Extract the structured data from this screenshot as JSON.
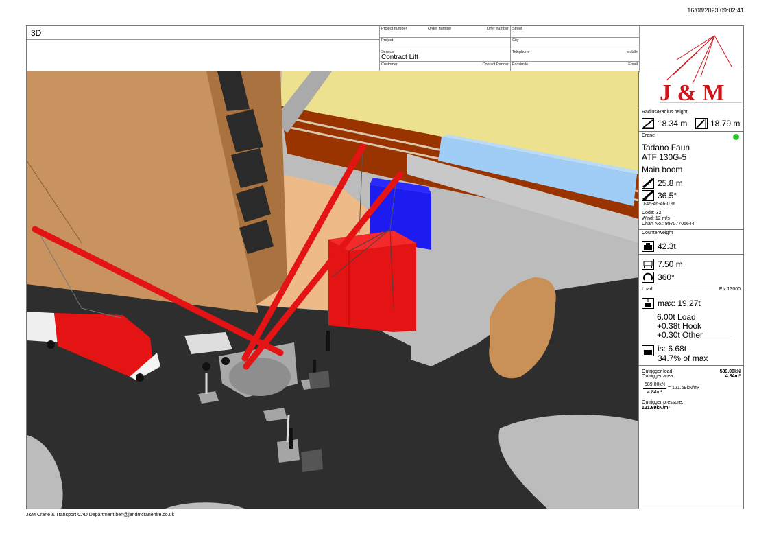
{
  "timestamp": "16/08/2023 09:02:41",
  "view_title": "3D",
  "header": {
    "project_number_label": "Project number",
    "order_number_label": "Order number",
    "offer_number_label": "Offer number",
    "street_label": "Street",
    "project_label": "Project",
    "city_label": "City",
    "service_label": "Service",
    "service_value": "Contract Lift",
    "telephone_label": "Telephone",
    "mobile_label": "Mobile",
    "customer_label": "Customer",
    "contact_partner_label": "Contact Partner",
    "facsimile_label": "Facsimile",
    "email_label": "Email"
  },
  "logo": {
    "text": "J & M",
    "color": "#d0141b"
  },
  "radius": {
    "label": "Radius/Radius height",
    "radius_value": "18.34 m",
    "height_value": "18.79 m"
  },
  "crane": {
    "label": "Crane",
    "badge": "1",
    "make": "Tadano Faun",
    "model": "ATF 130G-5",
    "boom_type": "Main boom",
    "boom_length": "25.8 m",
    "boom_angle": "36.5°",
    "telescoping": "0-46-46-46-0 %",
    "code": "Code: 32",
    "wind": "Wind: 12 m/s",
    "chart_no": "Chart No.: 99707705644"
  },
  "counterweight": {
    "label": "Counterweight",
    "value": "42.3t"
  },
  "outrigger_base": {
    "span": "7.50 m",
    "slew": "360°"
  },
  "load": {
    "label": "Load",
    "standard": "EN 13000",
    "max": "max: 19.27t",
    "line1": "6.00t Load",
    "line2": "+0.38t Hook",
    "line3": "+0.30t Other",
    "is": "is: 6.68t",
    "percent": "34.7% of max"
  },
  "outrigger": {
    "load_label": "Outrigger load:",
    "load_value": "589.00kN",
    "area_label": "Outrigger area:",
    "area_value": "4.84m²",
    "frac_num": "589.00kN",
    "frac_den": "4.84m²",
    "frac_result": "= 121.69kN/m²",
    "pressure_label": "Outrigger pressure:",
    "pressure_value": "121.69kN/m²"
  },
  "footer": "J&M Crane & Transport CAD Department ben@jandmcranehire.co.uk",
  "colors": {
    "building": "#c8935f",
    "sand": "#eebb88",
    "road": "#2e2e2e",
    "pavement": "#bcbcbc",
    "yellow_roof": "#ede08e",
    "brick": "#993300",
    "boom_red": "#e41414",
    "blue_box": "#1c1cf0",
    "light_blue": "#9fcdf5",
    "dirt": "#c99058"
  }
}
